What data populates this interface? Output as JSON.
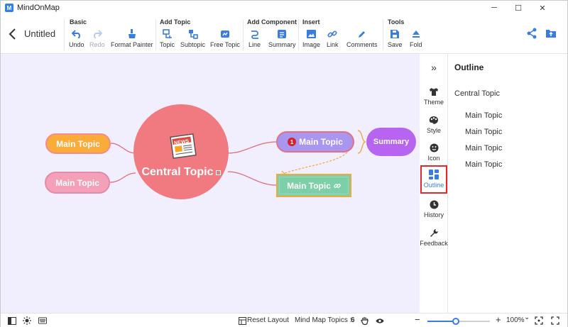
{
  "window": {
    "app_name": "MindOnMap",
    "minimize_glyph": "─",
    "maximize_glyph": "☐",
    "close_glyph": "✕"
  },
  "header": {
    "back_icon": "chevron-left-icon",
    "doc_title": "Untitled"
  },
  "toolbar": {
    "groups": [
      {
        "label": "Basic",
        "tools": [
          {
            "label": "Undo",
            "icon": "undo-icon",
            "enabled": true
          },
          {
            "label": "Redo",
            "icon": "redo-icon",
            "enabled": false
          },
          {
            "label": "Format Painter",
            "icon": "brush-icon",
            "enabled": true
          }
        ]
      },
      {
        "label": "Add Topic",
        "tools": [
          {
            "label": "Topic",
            "icon": "topic-icon",
            "enabled": true
          },
          {
            "label": "Subtopic",
            "icon": "subtopic-icon",
            "enabled": true
          },
          {
            "label": "Free Topic",
            "icon": "free-topic-icon",
            "enabled": true
          }
        ]
      },
      {
        "label": "Add Component",
        "tools": [
          {
            "label": "Line",
            "icon": "line-icon",
            "enabled": true
          },
          {
            "label": "Summary",
            "icon": "summary-icon",
            "enabled": true
          }
        ]
      },
      {
        "label": "Insert",
        "tools": [
          {
            "label": "Image",
            "icon": "image-icon",
            "enabled": true
          },
          {
            "label": "Link",
            "icon": "link-icon",
            "enabled": true
          },
          {
            "label": "Comments",
            "icon": "comments-icon",
            "enabled": true
          }
        ]
      },
      {
        "label": "Tools",
        "tools": [
          {
            "label": "Save",
            "icon": "save-icon",
            "enabled": true
          },
          {
            "label": "Fold",
            "icon": "fold-icon",
            "enabled": true
          }
        ]
      }
    ],
    "share_icon": "share-icon",
    "export_icon": "export-icon",
    "accent": "#3b7ddd"
  },
  "canvas": {
    "background": "#f1eefd",
    "central_topic": "Central Topic",
    "left_topic_1": "Main Topic",
    "left_topic_2": "Main Topic",
    "right_topic_1": "Main Topic",
    "right_topic_1_badge": "1",
    "right_topic_2": "Main Topic",
    "summary": "Summary",
    "link_glyph": "🔗"
  },
  "sidebar": {
    "collapse_glyph": "»",
    "items": [
      {
        "label": "Theme",
        "icon": "shirt-icon",
        "active": false
      },
      {
        "label": "Style",
        "icon": "palette-icon",
        "active": false
      },
      {
        "label": "Icon",
        "icon": "smiley-icon",
        "active": false
      },
      {
        "label": "Outline",
        "icon": "outline-icon",
        "active": true
      },
      {
        "label": "History",
        "icon": "clock-icon",
        "active": false
      },
      {
        "label": "Feedback",
        "icon": "wrench-icon",
        "active": false
      }
    ]
  },
  "outline": {
    "title": "Outline",
    "root": "Central Topic",
    "children": [
      "Main Topic",
      "Main Topic",
      "Main Topic",
      "Main Topic"
    ]
  },
  "statusbar": {
    "reset_layout": "Reset Layout",
    "topics_label": "Mind Map Topics :",
    "topics_count": "6",
    "zoom_minus": "−",
    "zoom_plus": "+",
    "zoom_value": "100%",
    "zoom_dropdown": "⌄",
    "zoom_fraction": 0.45
  }
}
